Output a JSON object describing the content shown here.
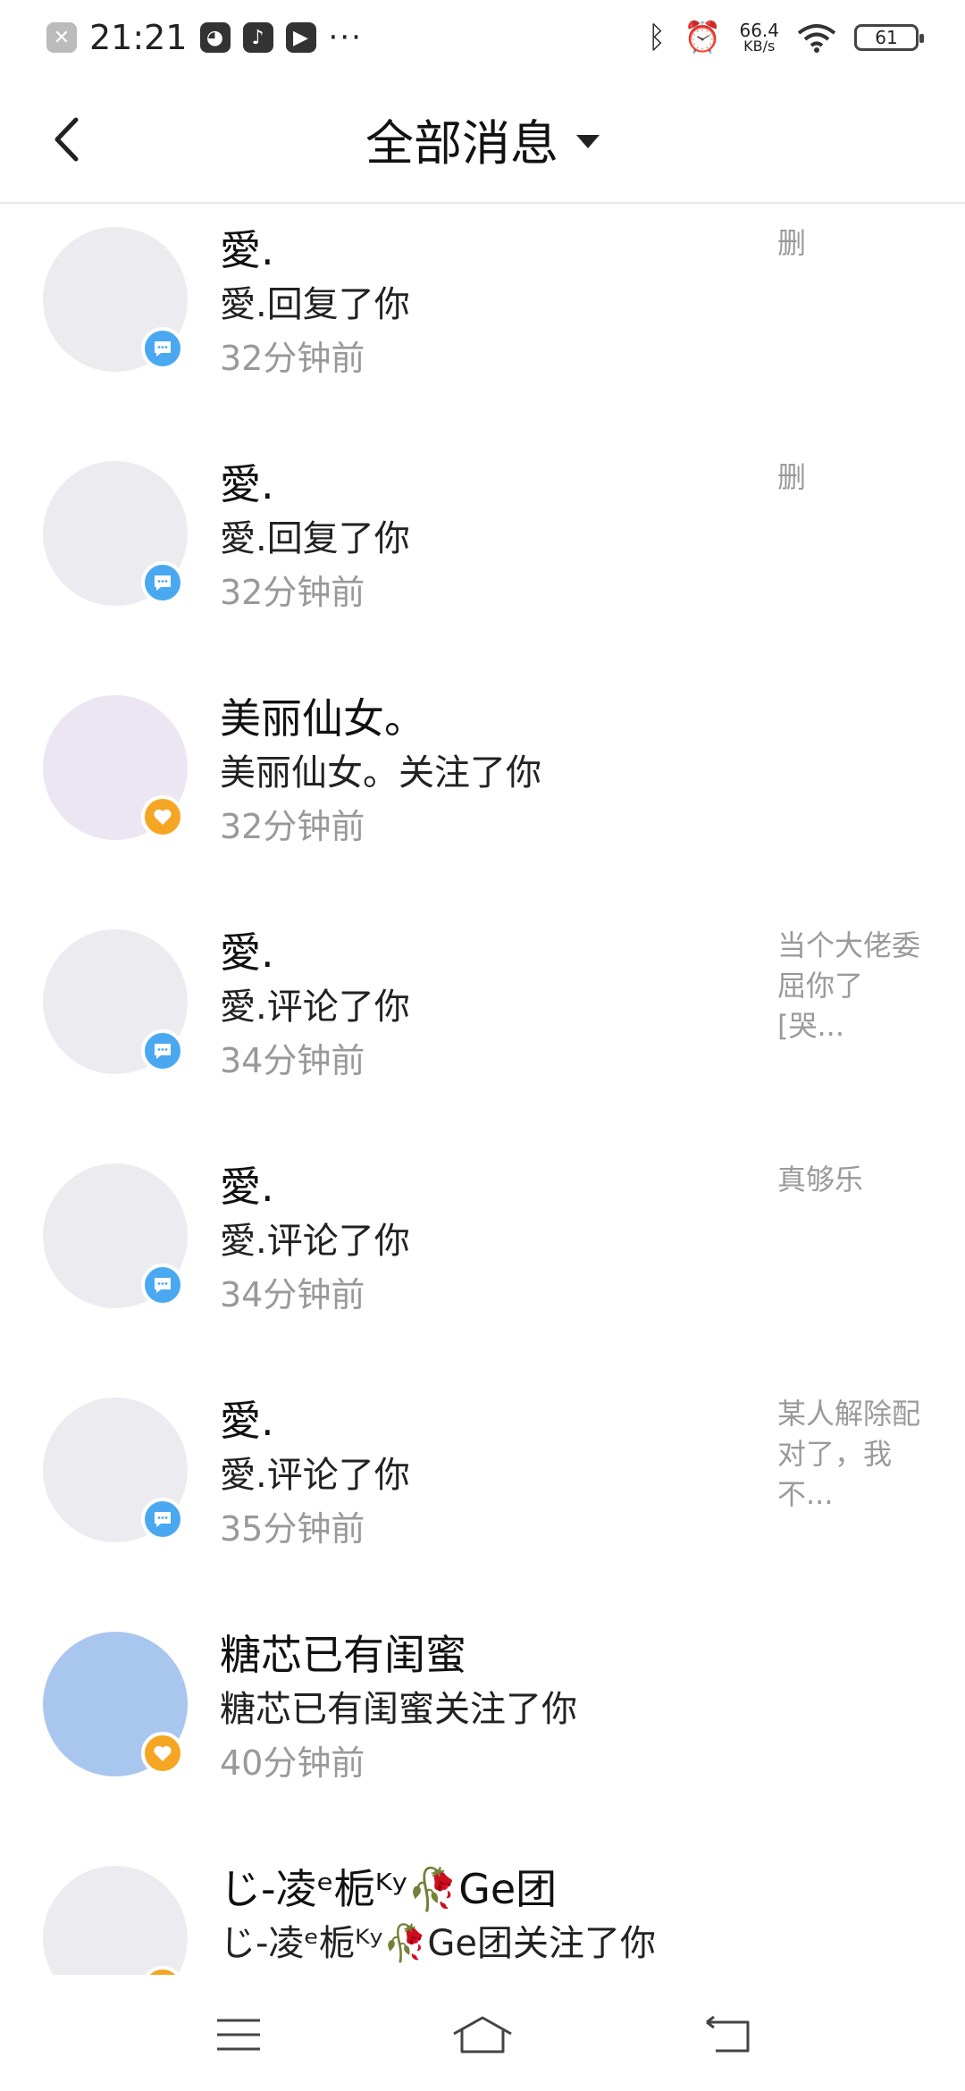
{
  "status_bar": {
    "time": "21:21",
    "net_speed": "66.4",
    "net_unit": "KB/s",
    "battery": "61"
  },
  "header": {
    "title": "全部消息"
  },
  "messages": [
    {
      "name": "愛.",
      "action": "愛.回复了你",
      "time": "32分钟前",
      "preview": "删",
      "badge": "comment",
      "avatar_color": "#ececf0"
    },
    {
      "name": "愛.",
      "action": "愛.回复了你",
      "time": "32分钟前",
      "preview": "删",
      "badge": "comment",
      "avatar_color": "#ececf0"
    },
    {
      "name": "美丽仙女。",
      "action": "美丽仙女。关注了你",
      "time": "32分钟前",
      "preview": "",
      "badge": "heart",
      "avatar_color": "#ece6f2"
    },
    {
      "name": "愛.",
      "action": "愛.评论了你",
      "time": "34分钟前",
      "preview": "当个大佬委屈你了[哭...",
      "badge": "comment",
      "avatar_color": "#ececf0"
    },
    {
      "name": "愛.",
      "action": "愛.评论了你",
      "time": "34分钟前",
      "preview": "真够乐",
      "badge": "comment",
      "avatar_color": "#ececf0"
    },
    {
      "name": "愛.",
      "action": "愛.评论了你",
      "time": "35分钟前",
      "preview": "某人解除配对了，我不...",
      "badge": "comment",
      "avatar_color": "#ececf0"
    },
    {
      "name": "糖芯已有闺蜜",
      "action": "糖芯已有闺蜜关注了你",
      "time": "40分钟前",
      "preview": "",
      "badge": "heart",
      "avatar_color": "#a9c6ee"
    },
    {
      "name": "じ-凌ᵉ栀ᴷʸ🥀Ge团",
      "action": "じ-凌ᵉ栀ᴷʸ🥀Ge团关注了你",
      "time": "",
      "preview": "",
      "badge": "heart",
      "avatar_color": "#ececf0"
    }
  ],
  "colors": {
    "comment_badge": "#4aa8f0",
    "heart_badge": "#f5a623",
    "muted_text": "#999999"
  }
}
